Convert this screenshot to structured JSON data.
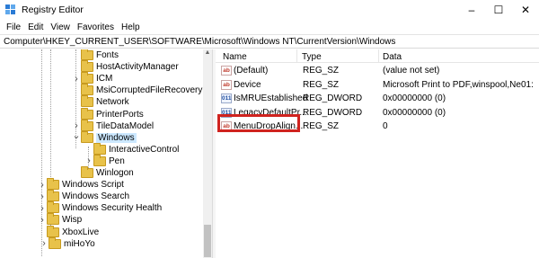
{
  "window": {
    "title": "Registry Editor",
    "controls": {
      "minimize": "–",
      "maximize": "☐",
      "close": "✕"
    }
  },
  "menu": [
    "File",
    "Edit",
    "View",
    "Favorites",
    "Help"
  ],
  "address": "Computer\\HKEY_CURRENT_USER\\SOFTWARE\\Microsoft\\Windows NT\\CurrentVersion\\Windows",
  "tree": {
    "items": [
      {
        "label": "Fonts",
        "expandable": false,
        "selected": false
      },
      {
        "label": "HostActivityManager",
        "expandable": false,
        "selected": false
      },
      {
        "label": "ICM",
        "expandable": true,
        "selected": false
      },
      {
        "label": "MsiCorruptedFileRecovery",
        "expandable": false,
        "selected": false
      },
      {
        "label": "Network",
        "expandable": false,
        "selected": false
      },
      {
        "label": "PrinterPorts",
        "expandable": false,
        "selected": false
      },
      {
        "label": "TileDataModel",
        "expandable": true,
        "selected": false
      },
      {
        "label": "Windows",
        "expandable": true,
        "expanded": true,
        "selected": true
      },
      {
        "label": "InteractiveControl",
        "expandable": false,
        "selected": false
      },
      {
        "label": "Pen",
        "expandable": true,
        "selected": false
      },
      {
        "label": "Winlogon",
        "expandable": false,
        "selected": false
      },
      {
        "label": "Windows Script",
        "expandable": true,
        "selected": false
      },
      {
        "label": "Windows Search",
        "expandable": true,
        "selected": false
      },
      {
        "label": "Windows Security Health",
        "expandable": true,
        "selected": false
      },
      {
        "label": "Wisp",
        "expandable": true,
        "selected": false
      },
      {
        "label": "XboxLive",
        "expandable": false,
        "selected": false
      },
      {
        "label": "miHoYo",
        "expandable": true,
        "selected": false
      }
    ]
  },
  "values": {
    "columns": {
      "name": "Name",
      "type": "Type",
      "data": "Data"
    },
    "rows": [
      {
        "icon": "ab",
        "name": "(Default)",
        "type": "REG_SZ",
        "data": "(value not set)"
      },
      {
        "icon": "ab",
        "name": "Device",
        "type": "REG_SZ",
        "data": "Microsoft Print to PDF,winspool,Ne01:"
      },
      {
        "icon": "011",
        "name": "IsMRUEstablished",
        "type": "REG_DWORD",
        "data": "0x00000000 (0)"
      },
      {
        "icon": "011",
        "name": "LegacyDefaultPr...",
        "type": "REG_DWORD",
        "data": "0x00000000 (0)"
      },
      {
        "icon": "ab",
        "name": "MenuDropAlign...",
        "type": "REG_SZ",
        "data": "0"
      }
    ],
    "highlight_color": "#d0231f"
  },
  "colors": {
    "selection": "#cce8ff",
    "folder": "#e8c24a"
  }
}
